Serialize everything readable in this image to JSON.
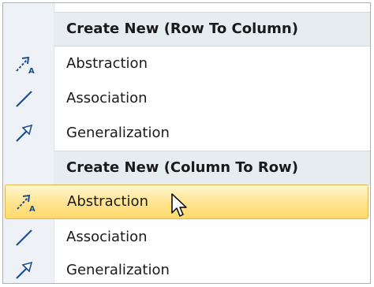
{
  "menu": {
    "sections": [
      {
        "header": "Create New (Row To Column)",
        "items": [
          {
            "label": "Abstraction",
            "icon": "abstraction-icon"
          },
          {
            "label": "Association",
            "icon": "association-icon"
          },
          {
            "label": "Generalization",
            "icon": "generalization-icon"
          }
        ]
      },
      {
        "header": "Create New (Column To Row)",
        "items": [
          {
            "label": "Abstraction",
            "icon": "abstraction-icon",
            "highlighted": true
          },
          {
            "label": "Association",
            "icon": "association-icon"
          },
          {
            "label": "Generalization",
            "icon": "generalization-icon"
          }
        ]
      }
    ]
  },
  "colors": {
    "highlight_border": "#e3b84a",
    "highlight_fill": "#ffe38f",
    "header_fill": "#e7ecf1",
    "gutter_fill": "#eef1f5",
    "icon_blue": "#1f4e8c"
  }
}
